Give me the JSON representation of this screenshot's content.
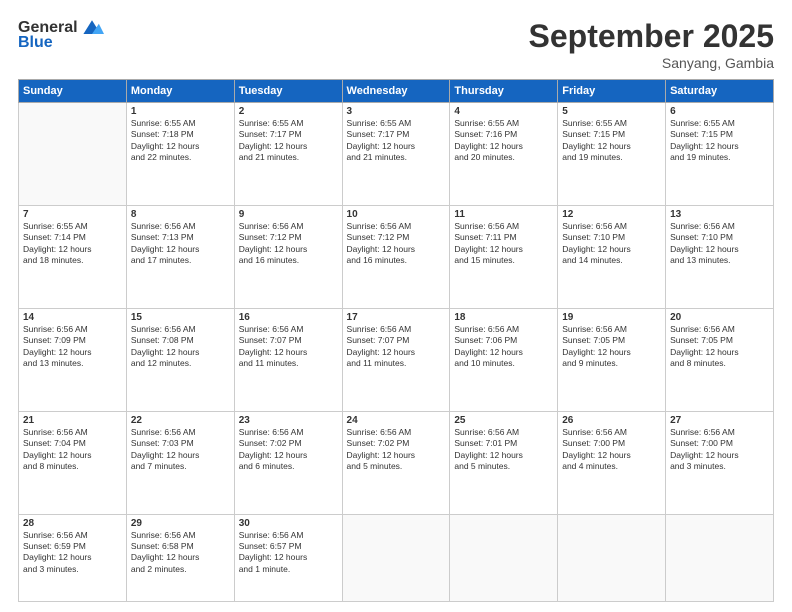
{
  "header": {
    "logo_general": "General",
    "logo_blue": "Blue",
    "month": "September 2025",
    "location": "Sanyang, Gambia"
  },
  "weekdays": [
    "Sunday",
    "Monday",
    "Tuesday",
    "Wednesday",
    "Thursday",
    "Friday",
    "Saturday"
  ],
  "weeks": [
    [
      {
        "day": "",
        "info": ""
      },
      {
        "day": "1",
        "info": "Sunrise: 6:55 AM\nSunset: 7:18 PM\nDaylight: 12 hours\nand 22 minutes."
      },
      {
        "day": "2",
        "info": "Sunrise: 6:55 AM\nSunset: 7:17 PM\nDaylight: 12 hours\nand 21 minutes."
      },
      {
        "day": "3",
        "info": "Sunrise: 6:55 AM\nSunset: 7:17 PM\nDaylight: 12 hours\nand 21 minutes."
      },
      {
        "day": "4",
        "info": "Sunrise: 6:55 AM\nSunset: 7:16 PM\nDaylight: 12 hours\nand 20 minutes."
      },
      {
        "day": "5",
        "info": "Sunrise: 6:55 AM\nSunset: 7:15 PM\nDaylight: 12 hours\nand 19 minutes."
      },
      {
        "day": "6",
        "info": "Sunrise: 6:55 AM\nSunset: 7:15 PM\nDaylight: 12 hours\nand 19 minutes."
      }
    ],
    [
      {
        "day": "7",
        "info": "Sunrise: 6:55 AM\nSunset: 7:14 PM\nDaylight: 12 hours\nand 18 minutes."
      },
      {
        "day": "8",
        "info": "Sunrise: 6:56 AM\nSunset: 7:13 PM\nDaylight: 12 hours\nand 17 minutes."
      },
      {
        "day": "9",
        "info": "Sunrise: 6:56 AM\nSunset: 7:12 PM\nDaylight: 12 hours\nand 16 minutes."
      },
      {
        "day": "10",
        "info": "Sunrise: 6:56 AM\nSunset: 7:12 PM\nDaylight: 12 hours\nand 16 minutes."
      },
      {
        "day": "11",
        "info": "Sunrise: 6:56 AM\nSunset: 7:11 PM\nDaylight: 12 hours\nand 15 minutes."
      },
      {
        "day": "12",
        "info": "Sunrise: 6:56 AM\nSunset: 7:10 PM\nDaylight: 12 hours\nand 14 minutes."
      },
      {
        "day": "13",
        "info": "Sunrise: 6:56 AM\nSunset: 7:10 PM\nDaylight: 12 hours\nand 13 minutes."
      }
    ],
    [
      {
        "day": "14",
        "info": "Sunrise: 6:56 AM\nSunset: 7:09 PM\nDaylight: 12 hours\nand 13 minutes."
      },
      {
        "day": "15",
        "info": "Sunrise: 6:56 AM\nSunset: 7:08 PM\nDaylight: 12 hours\nand 12 minutes."
      },
      {
        "day": "16",
        "info": "Sunrise: 6:56 AM\nSunset: 7:07 PM\nDaylight: 12 hours\nand 11 minutes."
      },
      {
        "day": "17",
        "info": "Sunrise: 6:56 AM\nSunset: 7:07 PM\nDaylight: 12 hours\nand 11 minutes."
      },
      {
        "day": "18",
        "info": "Sunrise: 6:56 AM\nSunset: 7:06 PM\nDaylight: 12 hours\nand 10 minutes."
      },
      {
        "day": "19",
        "info": "Sunrise: 6:56 AM\nSunset: 7:05 PM\nDaylight: 12 hours\nand 9 minutes."
      },
      {
        "day": "20",
        "info": "Sunrise: 6:56 AM\nSunset: 7:05 PM\nDaylight: 12 hours\nand 8 minutes."
      }
    ],
    [
      {
        "day": "21",
        "info": "Sunrise: 6:56 AM\nSunset: 7:04 PM\nDaylight: 12 hours\nand 8 minutes."
      },
      {
        "day": "22",
        "info": "Sunrise: 6:56 AM\nSunset: 7:03 PM\nDaylight: 12 hours\nand 7 minutes."
      },
      {
        "day": "23",
        "info": "Sunrise: 6:56 AM\nSunset: 7:02 PM\nDaylight: 12 hours\nand 6 minutes."
      },
      {
        "day": "24",
        "info": "Sunrise: 6:56 AM\nSunset: 7:02 PM\nDaylight: 12 hours\nand 5 minutes."
      },
      {
        "day": "25",
        "info": "Sunrise: 6:56 AM\nSunset: 7:01 PM\nDaylight: 12 hours\nand 5 minutes."
      },
      {
        "day": "26",
        "info": "Sunrise: 6:56 AM\nSunset: 7:00 PM\nDaylight: 12 hours\nand 4 minutes."
      },
      {
        "day": "27",
        "info": "Sunrise: 6:56 AM\nSunset: 7:00 PM\nDaylight: 12 hours\nand 3 minutes."
      }
    ],
    [
      {
        "day": "28",
        "info": "Sunrise: 6:56 AM\nSunset: 6:59 PM\nDaylight: 12 hours\nand 3 minutes."
      },
      {
        "day": "29",
        "info": "Sunrise: 6:56 AM\nSunset: 6:58 PM\nDaylight: 12 hours\nand 2 minutes."
      },
      {
        "day": "30",
        "info": "Sunrise: 6:56 AM\nSunset: 6:57 PM\nDaylight: 12 hours\nand 1 minute."
      },
      {
        "day": "",
        "info": ""
      },
      {
        "day": "",
        "info": ""
      },
      {
        "day": "",
        "info": ""
      },
      {
        "day": "",
        "info": ""
      }
    ]
  ]
}
